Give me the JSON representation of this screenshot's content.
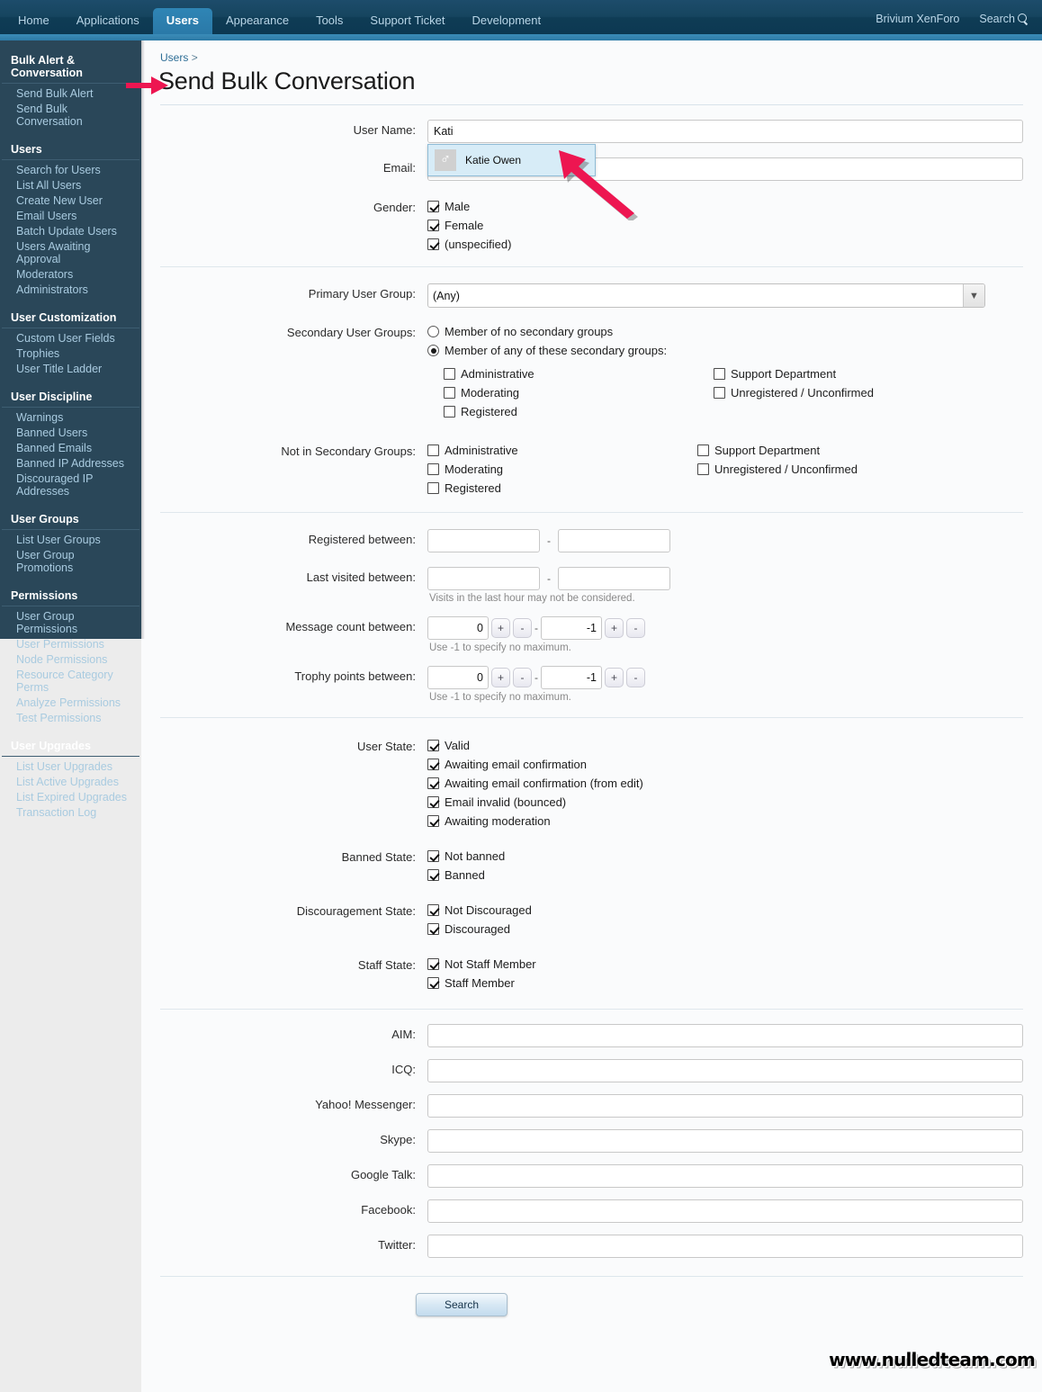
{
  "topnav": {
    "tabs": [
      {
        "label": "Home",
        "active": false
      },
      {
        "label": "Applications",
        "active": false
      },
      {
        "label": "Users",
        "active": true
      },
      {
        "label": "Appearance",
        "active": false
      },
      {
        "label": "Tools",
        "active": false
      },
      {
        "label": "Support Ticket",
        "active": false
      },
      {
        "label": "Development",
        "active": false
      }
    ],
    "account_label": "Brivium XenForo",
    "search_label": "Search"
  },
  "sidebar": {
    "groups": [
      {
        "title": "Bulk Alert & Conversation",
        "items": [
          {
            "label": "Send Bulk Alert"
          },
          {
            "label": "Send Bulk Conversation"
          }
        ]
      },
      {
        "title": "Users",
        "items": [
          {
            "label": "Search for Users"
          },
          {
            "label": "List All Users"
          },
          {
            "label": "Create New User"
          },
          {
            "label": "Email Users"
          },
          {
            "label": "Batch Update Users"
          },
          {
            "label": "Users Awaiting Approval"
          },
          {
            "label": "Moderators"
          },
          {
            "label": "Administrators"
          }
        ]
      },
      {
        "title": "User Customization",
        "items": [
          {
            "label": "Custom User Fields"
          },
          {
            "label": "Trophies"
          },
          {
            "label": "User Title Ladder"
          }
        ]
      },
      {
        "title": "User Discipline",
        "items": [
          {
            "label": "Warnings"
          },
          {
            "label": "Banned Users"
          },
          {
            "label": "Banned Emails"
          },
          {
            "label": "Banned IP Addresses"
          },
          {
            "label": "Discouraged IP Addresses"
          }
        ]
      },
      {
        "title": "User Groups",
        "items": [
          {
            "label": "List User Groups"
          },
          {
            "label": "User Group Promotions"
          }
        ]
      },
      {
        "title": "Permissions",
        "items": [
          {
            "label": "User Group Permissions"
          },
          {
            "label": "User Permissions"
          },
          {
            "label": "Node Permissions"
          },
          {
            "label": "Resource Category Perms"
          },
          {
            "label": "Analyze Permissions"
          },
          {
            "label": "Test Permissions"
          }
        ]
      },
      {
        "title": "User Upgrades",
        "items": [
          {
            "label": "List User Upgrades"
          },
          {
            "label": "List Active Upgrades"
          },
          {
            "label": "List Expired Upgrades"
          },
          {
            "label": "Transaction Log"
          }
        ]
      }
    ]
  },
  "page": {
    "breadcrumb_root": "Users",
    "breadcrumb_sep": ">",
    "title": "Send Bulk Conversation"
  },
  "form": {
    "user_name": {
      "label": "User Name:",
      "value": "Kati",
      "autocomplete": [
        {
          "name": "Katie Owen",
          "avatar_icon": "male-gender-icon",
          "glyph": "♂"
        }
      ]
    },
    "email": {
      "label": "Email:",
      "value": ""
    },
    "gender": {
      "label": "Gender:",
      "options": [
        {
          "label": "Male",
          "checked": true
        },
        {
          "label": "Female",
          "checked": true
        },
        {
          "label": "(unspecified)",
          "checked": true
        }
      ]
    },
    "primary_user_group": {
      "label": "Primary User Group:",
      "selected": "(Any)",
      "options": [
        "(Any)"
      ]
    },
    "secondary_user_groups": {
      "label": "Secondary User Groups:",
      "radios": [
        {
          "label": "Member of no secondary groups",
          "checked": false
        },
        {
          "label": "Member of any of these secondary groups:",
          "checked": true
        }
      ],
      "col_left": [
        {
          "label": "Administrative",
          "checked": false
        },
        {
          "label": "Moderating",
          "checked": false
        },
        {
          "label": "Registered",
          "checked": false
        }
      ],
      "col_right": [
        {
          "label": "Support Department",
          "checked": false
        },
        {
          "label": "Unregistered / Unconfirmed",
          "checked": false
        }
      ]
    },
    "not_in_secondary_groups": {
      "label": "Not in Secondary Groups:",
      "col_left": [
        {
          "label": "Administrative",
          "checked": false
        },
        {
          "label": "Moderating",
          "checked": false
        },
        {
          "label": "Registered",
          "checked": false
        }
      ],
      "col_right": [
        {
          "label": "Support Department",
          "checked": false
        },
        {
          "label": "Unregistered / Unconfirmed",
          "checked": false
        }
      ]
    },
    "registered_between": {
      "label": "Registered between:",
      "from": "",
      "to": "",
      "sep": "-"
    },
    "last_visited_between": {
      "label": "Last visited between:",
      "from": "",
      "to": "",
      "sep": "-",
      "hint": "Visits in the last hour may not be considered."
    },
    "message_count_between": {
      "label": "Message count between:",
      "min": "0",
      "max": "-1",
      "sep": "-",
      "plus": "+",
      "minus": "-",
      "hint": "Use -1 to specify no maximum."
    },
    "trophy_points_between": {
      "label": "Trophy points between:",
      "min": "0",
      "max": "-1",
      "sep": "-",
      "plus": "+",
      "minus": "-",
      "hint": "Use -1 to specify no maximum."
    },
    "user_state": {
      "label": "User State:",
      "options": [
        {
          "label": "Valid",
          "checked": true
        },
        {
          "label": "Awaiting email confirmation",
          "checked": true
        },
        {
          "label": "Awaiting email confirmation (from edit)",
          "checked": true
        },
        {
          "label": "Email invalid (bounced)",
          "checked": true
        },
        {
          "label": "Awaiting moderation",
          "checked": true
        }
      ]
    },
    "banned_state": {
      "label": "Banned State:",
      "options": [
        {
          "label": "Not banned",
          "checked": true
        },
        {
          "label": "Banned",
          "checked": true
        }
      ]
    },
    "discouragement_state": {
      "label": "Discouragement State:",
      "options": [
        {
          "label": "Not Discouraged",
          "checked": true
        },
        {
          "label": "Discouraged",
          "checked": true
        }
      ]
    },
    "staff_state": {
      "label": "Staff State:",
      "options": [
        {
          "label": "Not Staff Member",
          "checked": true
        },
        {
          "label": "Staff Member",
          "checked": true
        }
      ]
    },
    "contact_fields": [
      {
        "label": "AIM:",
        "value": ""
      },
      {
        "label": "ICQ:",
        "value": ""
      },
      {
        "label": "Yahoo! Messenger:",
        "value": ""
      },
      {
        "label": "Skype:",
        "value": ""
      },
      {
        "label": "Google Talk:",
        "value": ""
      },
      {
        "label": "Facebook:",
        "value": ""
      },
      {
        "label": "Twitter:",
        "value": ""
      }
    ],
    "submit_label": "Search"
  },
  "watermark": "www.nulledteam.com",
  "colors": {
    "topbar_dark": "#0f3c55",
    "topbar_strip": "#2d7aa6",
    "active_tab": "#2f85b5",
    "sidebar_bg": "#2a4759",
    "sidebar_link": "#a9cbe0",
    "content_bg": "#fafbfc",
    "link_blue": "#2e6e96",
    "annotation_arrow": "#ed1651",
    "autocomplete_bg": "#d7ecf7"
  }
}
